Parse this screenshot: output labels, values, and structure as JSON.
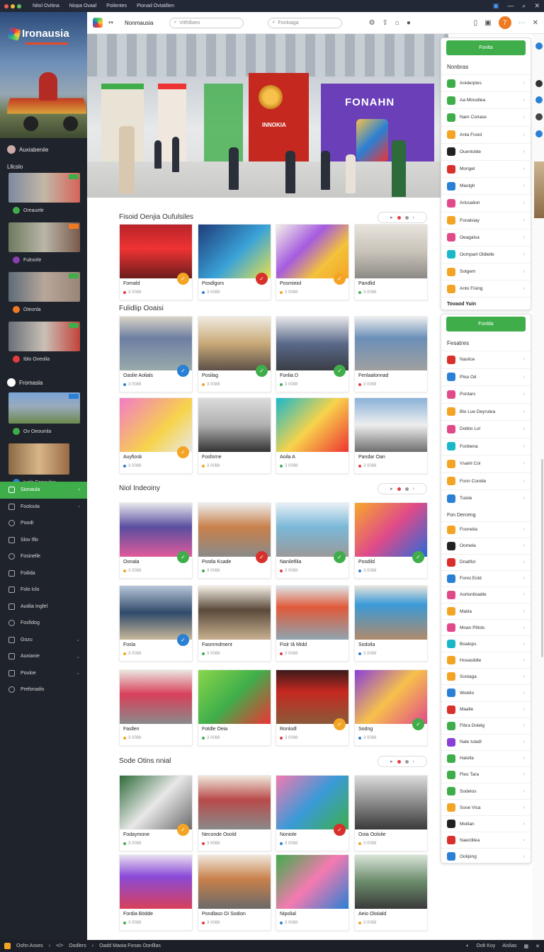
{
  "os_bar": {
    "tabs": [
      "Nitol Ovitina",
      "Niopa Ovaal",
      "Poilentes",
      "Pionad Ovtatilien"
    ]
  },
  "sidebar": {
    "logo": "Ironausia",
    "user_name": "Auxiabeniie",
    "section1_title": "Lllcslo",
    "section1_items": [
      "Oreauele",
      "Fulnorle",
      "Oteonla",
      "Iblo Oveolla"
    ],
    "section2_title": "Fromasla",
    "section2_items": [
      "Ov Oeoumla",
      "Iucla Fonaulna"
    ],
    "nav": [
      {
        "label": "Sionaula",
        "active": true
      },
      {
        "label": "Fooloula"
      },
      {
        "label": "Poodt"
      },
      {
        "label": "Slov Iflo"
      },
      {
        "label": "Fosinelle"
      },
      {
        "label": "Foilida"
      },
      {
        "label": "Folo Iclo"
      },
      {
        "label": "Autilia Ingfel"
      },
      {
        "label": "Fosfidog"
      },
      {
        "label": "Gozu"
      },
      {
        "label": "Auxianie"
      },
      {
        "label": "Pouloe"
      },
      {
        "label": "Prefonadis"
      }
    ]
  },
  "topbar": {
    "brand": "Nonmausia",
    "search1_placeholder": "Vitfnlloeo",
    "search2_placeholder": "Fonloaga",
    "notif_count": "7"
  },
  "hero": {
    "sign_main": "FONAHN",
    "sign_red": "INNOKIA"
  },
  "sections": [
    {
      "title": "Fisoid Oenjia   Oufulsiles",
      "cards": [
        {
          "caption": "Fomald",
          "meta": "3 0088",
          "badge_color": "#f4a425"
        },
        {
          "caption": "Posdlgors",
          "meta": "3 0088",
          "badge_color": "#d9302c"
        },
        {
          "caption": "Posmieiol",
          "meta": "3 0088",
          "badge_color": "#f4a425"
        },
        {
          "caption": "Pandlid",
          "meta": "3 0088",
          "badge_color": ""
        }
      ]
    },
    {
      "title": "Fulidlip Ooaisi",
      "cards": [
        {
          "caption": "Oaslie Aolials",
          "meta": "3 0088",
          "badge_color": "#2a80d4"
        },
        {
          "caption": "Posilag",
          "meta": "3 0088",
          "badge_color": "#3fae4a"
        },
        {
          "caption": "Fonlia D",
          "meta": "3 0088",
          "badge_color": "#3fae4a"
        },
        {
          "caption": "Fenlaalonnad",
          "meta": "3 0088",
          "badge_color": ""
        },
        {
          "caption": "Auyfiosk",
          "meta": "3 0088",
          "badge_color": "#f4a425"
        },
        {
          "caption": "Fosforne",
          "meta": "3 0088",
          "badge_color": ""
        },
        {
          "caption": "Aoila A",
          "meta": "3 0088",
          "badge_color": ""
        },
        {
          "caption": "Pandar Oan",
          "meta": "3 0088",
          "badge_color": ""
        }
      ]
    },
    {
      "title": "Niol Indeoiny",
      "cards": [
        {
          "caption": "Oonala",
          "meta": "3 0088",
          "badge_color": "#3fae4a"
        },
        {
          "caption": "Postla Ksade",
          "meta": "3 0088",
          "badge_color": "#d9302c"
        },
        {
          "caption": "Nanilefilia",
          "meta": "3 0088",
          "badge_color": "#3fae4a"
        },
        {
          "caption": "Posdild",
          "meta": "3 0088",
          "badge_color": "#3fae4a"
        },
        {
          "caption": "Fosla",
          "meta": "3 0088",
          "badge_color": "#2a80d4"
        },
        {
          "caption": "Fasmmdment",
          "meta": "3 0088",
          "badge_color": ""
        },
        {
          "caption": "Fislr Iâ Midd",
          "meta": "3 0088",
          "badge_color": ""
        },
        {
          "caption": "Sodolia",
          "meta": "3 0088",
          "badge_color": ""
        },
        {
          "caption": "Fasllen",
          "meta": "3 0088",
          "badge_color": ""
        },
        {
          "caption": "Fotdle Oeia",
          "meta": "3 0088",
          "badge_color": ""
        },
        {
          "caption": "Ronlodl",
          "meta": "3 0088",
          "badge_color": "#f4a425"
        },
        {
          "caption": "Sodng",
          "meta": "3 0088",
          "badge_color": "#3fae4a"
        }
      ]
    },
    {
      "title": "Sode Otins nnial",
      "cards": [
        {
          "caption": "Fodaymone",
          "meta": "3 0088",
          "badge_color": "#f4a425"
        },
        {
          "caption": "Neconde Ooold",
          "meta": "3 0088",
          "badge_color": ""
        },
        {
          "caption": "Noniole",
          "meta": "3 0088",
          "badge_color": "#d9302c"
        },
        {
          "caption": "Ooia Oololie",
          "meta": "3 0088",
          "badge_color": ""
        },
        {
          "caption": "Fordia Bödde",
          "meta": "3 0088",
          "badge_color": ""
        },
        {
          "caption": "Pondlaso Oi Sodion",
          "meta": "3 0088",
          "badge_color": ""
        },
        {
          "caption": "Nipolial",
          "meta": "3 0088",
          "badge_color": ""
        },
        {
          "caption": "Aeio Oloiiald",
          "meta": "3 0088",
          "badge_color": ""
        }
      ]
    }
  ],
  "right_panel_1": {
    "button": "Fonlta",
    "heading": "Nonbras",
    "items": [
      "Aniderples",
      "Aa Minodlea",
      "Nam Corlase",
      "Anta Fosid",
      "Ouentolde",
      "Morigel",
      "Maolgh",
      "Arlusalion",
      "Fonalsiay",
      "Oeagalsa",
      "Oompart Oldlelle",
      "Sotgem",
      "Anto Fising"
    ],
    "footer": "Tovaod Yuin"
  },
  "right_panel_2": {
    "button": "Fonlda",
    "heading": "Fesatres",
    "items": [
      "Nasilce",
      "Ploa Od",
      "Pontars",
      "Blo Lue Deyrutea",
      "Dolblo Lol",
      "Fonbena",
      "Vsainl Col",
      "Fonn Cooide",
      "Tuiole"
    ],
    "subheading": "Fon Derceng",
    "items2": [
      "Foonelia",
      "Oomela",
      "Dnatflol",
      "Fonsi Eold",
      "Aorlonlloadle",
      "Mailia",
      "Moan Pitlols",
      "Boalops",
      "Hceasildte",
      "Sostaga",
      "Woetio",
      "Maalle",
      "Fibra Dolelg",
      "Nale Iuladl",
      "Halolla",
      "Fleo Tara",
      "Sodelos",
      "Sooe Vica",
      "Moilian",
      "Naeclillea",
      "Ooliping"
    ]
  },
  "bottom_bar": {
    "left": [
      "Oohn Asses",
      "Oodlers",
      "Oadd Maoia Fonas Oonlllas"
    ],
    "right": [
      "Oolt Koy",
      "Aislias"
    ]
  }
}
